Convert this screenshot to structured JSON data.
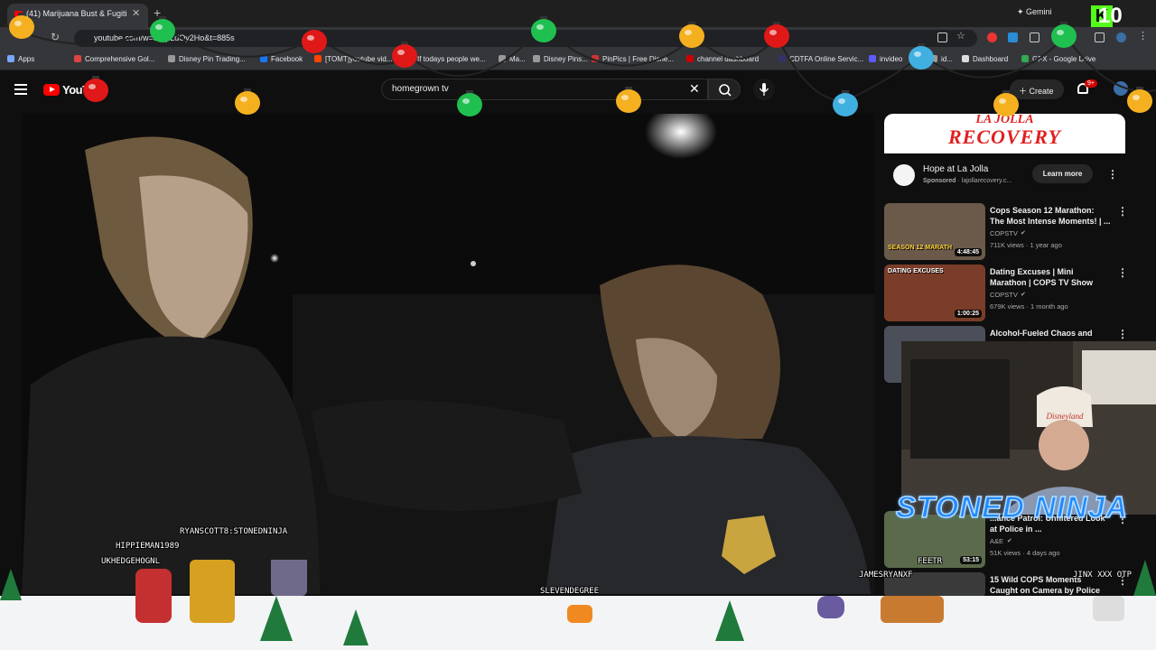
{
  "browser": {
    "tab_title": "(41) Marijuana Bust & Fugiti",
    "url": "youtube.com/w",
    "url_tail": "=ccJpLdOy2Ho&t=885s",
    "gemini_label": "Gemini",
    "bookmarks": [
      {
        "label": "Apps",
        "color": "#7aa7ff"
      },
      {
        "label": "Comprehensive Gol...",
        "color": "#d44"
      },
      {
        "label": "Disney Pin Trading...",
        "color": "#999"
      },
      {
        "label": "Facebook",
        "color": "#1877f2"
      },
      {
        "label": "[TOMT]youtube vid...",
        "color": "#ff4500"
      },
      {
        "label": "If todays people we...",
        "color": "#ff4500"
      },
      {
        "label": "Ma...",
        "color": "#999"
      },
      {
        "label": "Disney Pins...",
        "color": "#999"
      },
      {
        "label": "PinPics | Free Disne...",
        "color": "#c33"
      },
      {
        "label": "channel dashboard",
        "color": "#c00"
      },
      {
        "label": "CDTFA Online Servic...",
        "color": "#336"
      },
      {
        "label": "invideo",
        "color": "#5b5bff"
      },
      {
        "label": "id...",
        "color": "#999"
      },
      {
        "label": "Dashboard",
        "color": "#ddd"
      },
      {
        "label": "GFX - Google Drive",
        "color": "#34a853"
      }
    ]
  },
  "youtube": {
    "logo_text": "YouT",
    "search_query": "homegrown tv",
    "create_label": "Create",
    "notifications_badge": "9+"
  },
  "ad": {
    "banner_line1": "LA JOLLA",
    "banner_line2": "RECOVERY",
    "title": "Hope at La Jolla",
    "sponsored": "Sponsored",
    "domain": "· lajollarecovery.c...",
    "cta": "Learn more"
  },
  "recommendations": [
    {
      "title": "Cops Season 12 Marathon: The Most Intense Moments! | ...",
      "channel": "COPSTV",
      "meta": "711K views · 1 year ago",
      "duration": "4:48:45",
      "thumb_caption": "SEASON 12 MARATH",
      "thumb_color": "#6b5a4a"
    },
    {
      "title": "Dating Excuses | Mini Marathon | COPS TV Show",
      "channel": "COPSTV",
      "meta": "679K views · 1 month ago",
      "duration": "1:00:25",
      "thumb_caption": "DATING EXCUSES",
      "thumb_color": "#7a3d2a"
    },
    {
      "title": "Alcohol-Fueled Chaos and",
      "channel": "",
      "meta": "",
      "duration": "",
      "thumb_caption": "",
      "thumb_color": "#4b4f5a"
    },
    {
      "title": "...ance Patrol: Unfiltered Look at Police in ...",
      "channel": "A&E",
      "meta": "51K views · 4 days ago",
      "duration": "53:15",
      "thumb_caption": "",
      "thumb_color": "#5a6a4a"
    },
    {
      "title": "15 Wild COPS Moments Caught on Camera by Police",
      "channel": "",
      "meta": "",
      "duration": "",
      "thumb_caption": "",
      "thumb_color": "#3a3a3a"
    }
  ],
  "stream": {
    "overlay_title": "STONED NINJA",
    "counter": "10",
    "chat_names": [
      {
        "text": "RYANSCOTT8:STONEDNINJA"
      },
      {
        "text": "HIPPIEMAN1989"
      },
      {
        "text": "UKHEDGEHOGNL"
      },
      {
        "text": "SLEVENDEGREE"
      },
      {
        "text": "JAMESRYANXF"
      },
      {
        "text": "JINX XXX OTP"
      },
      {
        "text": "FEETR"
      }
    ]
  },
  "colors": {
    "youtube_red": "#ff0000",
    "page_bg": "#0f0f0f",
    "ninja_blue": "#1e8bff",
    "kick_green": "#53fc18"
  }
}
